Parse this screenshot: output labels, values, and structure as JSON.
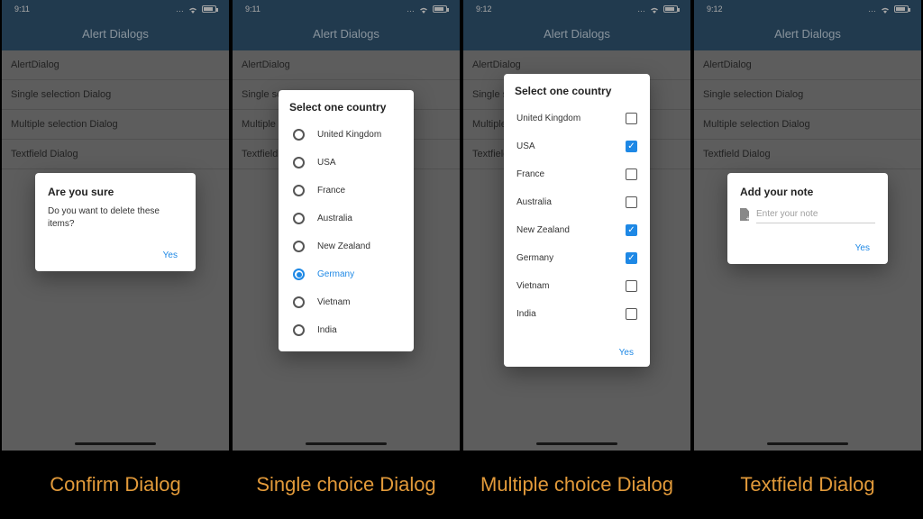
{
  "status": {
    "time1": "9:11",
    "time2": "9:12"
  },
  "appbar": {
    "title": "Alert Dialogs"
  },
  "menu": {
    "items": [
      {
        "label": "AlertDialog"
      },
      {
        "label": "Single selection Dialog"
      },
      {
        "label": "Multiple selection Dialog"
      },
      {
        "label": "Textfield Dialog"
      }
    ]
  },
  "confirm": {
    "title": "Are you sure",
    "body": "Do you want to delete these items?",
    "yes": "Yes"
  },
  "single": {
    "title": "Select one country",
    "selected": "Germany",
    "options": [
      "United Kingdom",
      "USA",
      "France",
      "Australia",
      "New Zealand",
      "Germany",
      "Vietnam",
      "India"
    ]
  },
  "multi": {
    "title": "Select one country",
    "yes": "Yes",
    "options": [
      {
        "label": "United Kingdom",
        "checked": false
      },
      {
        "label": "USA",
        "checked": true
      },
      {
        "label": "France",
        "checked": false
      },
      {
        "label": "Australia",
        "checked": false
      },
      {
        "label": "New Zealand",
        "checked": true
      },
      {
        "label": "Germany",
        "checked": true
      },
      {
        "label": "Vietnam",
        "checked": false
      },
      {
        "label": "India",
        "checked": false
      }
    ]
  },
  "textfield": {
    "title": "Add your note",
    "placeholder": "Enter your note",
    "yes": "Yes"
  },
  "captions": {
    "c1": "Confirm Dialog",
    "c2": "Single choice Dialog",
    "c3": "Multiple choice Dialog",
    "c4": "Textfield Dialog"
  }
}
